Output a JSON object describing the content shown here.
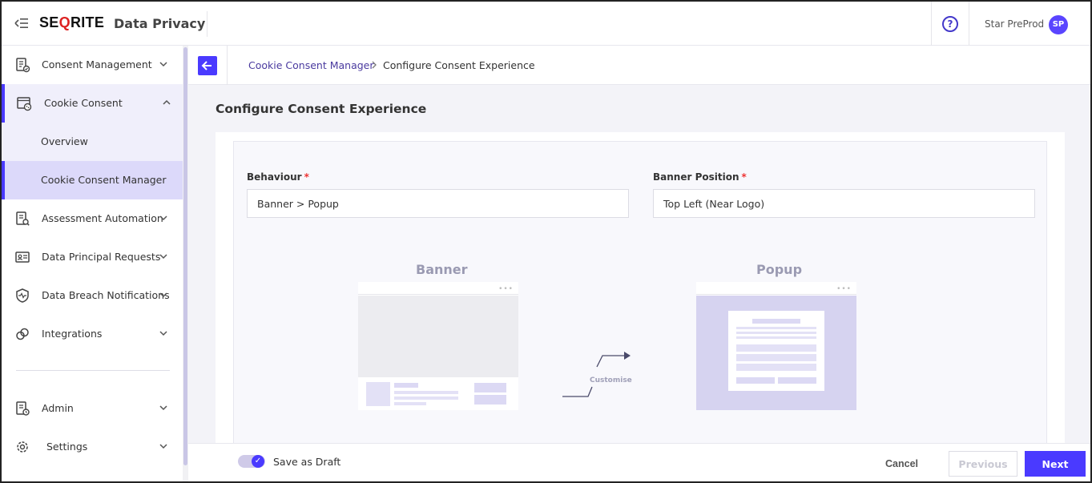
{
  "header": {
    "logo": "SEQRITE",
    "app_title": "Data Privacy",
    "help_symbol": "?",
    "user_name": "Star PreProd",
    "avatar_initials": "SP"
  },
  "sidebar": {
    "items": [
      {
        "label": "Consent Management",
        "icon": "consent-icon"
      },
      {
        "label": "Cookie Consent",
        "icon": "cookie-browser-icon"
      },
      {
        "label": "Overview"
      },
      {
        "label": "Cookie Consent Manager"
      },
      {
        "label": "Assessment Automation",
        "icon": "assessment-icon"
      },
      {
        "label": "Data Principal Requests",
        "icon": "id-card-icon"
      },
      {
        "label": "Data Breach Notifications",
        "icon": "shield-icon"
      },
      {
        "label": "Integrations",
        "icon": "link-icon"
      },
      {
        "label": "Admin",
        "icon": "admin-icon"
      },
      {
        "label": "Settings",
        "icon": "gear-icon"
      }
    ]
  },
  "breadcrumb": {
    "parent": "Cookie Consent Manager",
    "current": "Configure Consent Experience"
  },
  "page": {
    "title": "Configure Consent Experience",
    "behaviour_label": "Behaviour",
    "behaviour_value": "Banner > Popup",
    "position_label": "Banner Position",
    "position_value": "Top Left (Near Logo)",
    "required_mark": "*",
    "banner_title": "Banner",
    "popup_title": "Popup",
    "customise_label": "Customise",
    "dots": "•••"
  },
  "footer": {
    "draft_label": "Save as Draft",
    "draft_enabled": true,
    "cancel": "Cancel",
    "previous": "Previous",
    "next": "Next"
  },
  "colors": {
    "accent": "#4a3aff",
    "active_bg": "#dcd9fa",
    "open_bg": "#f0effb"
  }
}
